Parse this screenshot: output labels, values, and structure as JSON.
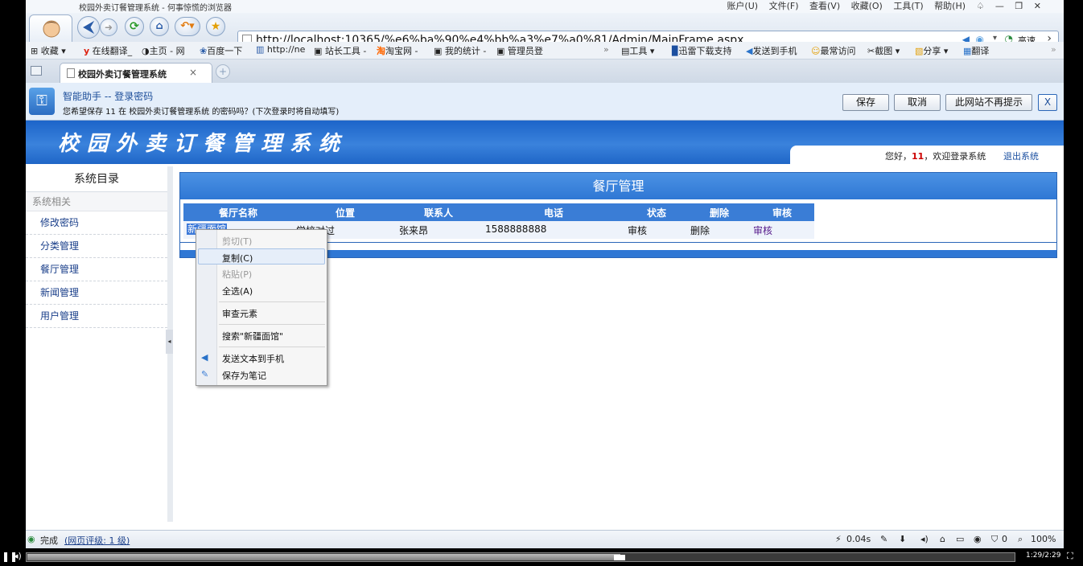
{
  "window": {
    "title": "校园外卖订餐管理系统 - 何事惊慌的浏览器",
    "menus": [
      "账户(U)",
      "文件(F)",
      "查看(V)",
      "收藏(O)",
      "工具(T)",
      "帮助(H)"
    ]
  },
  "address": {
    "url": "http://localhost:10365/%e6%ba%90%e4%bb%a3%e7%a0%81/Admin/MainFrame.aspx",
    "speed_label": "高速"
  },
  "favorites": {
    "items": [
      "收藏",
      "在线翻译_",
      "主页 - 网",
      "百度一下",
      "http://ne",
      "站长工具 -",
      "淘宝网 -",
      "我的统计 -",
      "管理员登"
    ],
    "right_items": [
      "工具",
      "迅雷下载支持",
      "发送到手机",
      "最常访问",
      "截图",
      "分享",
      "翻译"
    ],
    "more": "»"
  },
  "tab": {
    "label": "校园外卖订餐管理系统",
    "close": "×"
  },
  "helper": {
    "title": "智能助手 -- 登录密码",
    "message": "您希望保存 11 在 校园外卖订餐管理系统 的密码吗？(下次登录时将自动填写)",
    "save": "保存",
    "cancel": "取消",
    "never": "此网站不再提示",
    "close": "X"
  },
  "banner": {
    "title": "校园外卖订餐管理系统",
    "greeting_pre": "您好，",
    "username": "11",
    "greeting_post": "，欢迎登录系统",
    "logout": "退出系统"
  },
  "sidebar": {
    "heading": "系统目录",
    "section": "系统相关",
    "items": [
      "修改密码",
      "分类管理",
      "餐厅管理",
      "新闻管理",
      "用户管理"
    ]
  },
  "panel": {
    "title": "餐厅管理",
    "columns": [
      "餐厅名称",
      "位置",
      "联系人",
      "电话",
      "状态",
      "删除",
      "审核"
    ],
    "rows": [
      {
        "name": "新疆面馆",
        "location": "学校对过",
        "contact": "张来昂",
        "phone": "1588888888",
        "status": "审核",
        "delete": "删除",
        "audit": "审核"
      }
    ]
  },
  "context_menu": {
    "items": [
      {
        "label": "剪切(T)",
        "enabled": false
      },
      {
        "label": "复制(C)",
        "enabled": true
      },
      {
        "label": "粘贴(P)",
        "enabled": false
      },
      {
        "label": "全选(A)",
        "enabled": true
      },
      {
        "label": "审查元素",
        "enabled": true
      },
      {
        "label": "搜索\"新疆面馆\"",
        "enabled": true
      },
      {
        "label": "发送文本到手机",
        "enabled": true
      },
      {
        "label": "保存为笔记",
        "enabled": true
      }
    ]
  },
  "status": {
    "done": "完成",
    "rating": "(网页评级: 1 级)",
    "time": "0.04s",
    "block_count": "0",
    "zoom": "100%"
  },
  "player": {
    "time": "1:29/2:29",
    "progress": 0.6
  },
  "colors": {
    "banner": "#1c64c9",
    "grid_header": "#3a7dd6",
    "username": "#cc0000",
    "link": "#1a3f8a"
  }
}
